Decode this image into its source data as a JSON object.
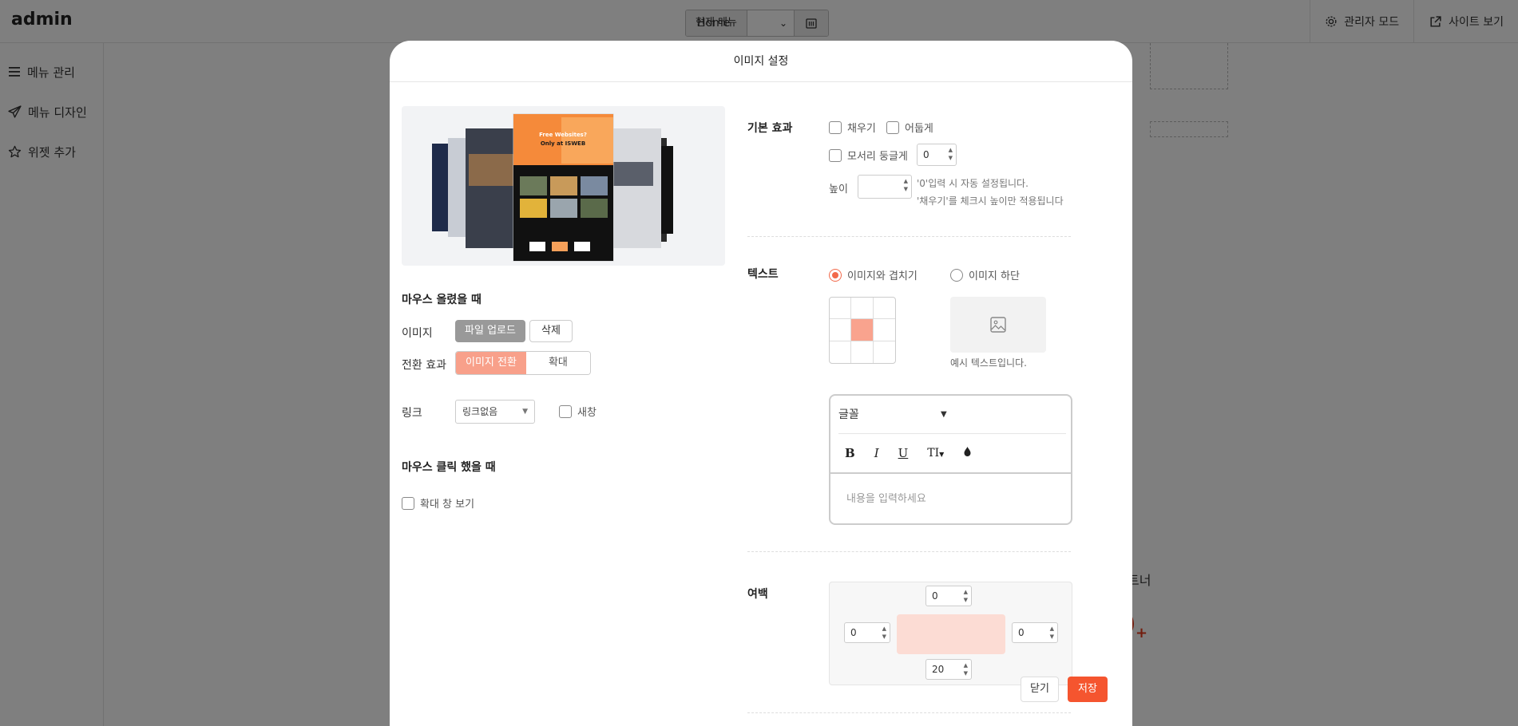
{
  "app": {
    "brand": "admin",
    "current_menu_label": "현재 메뉴",
    "current_menu_value": "Home",
    "admin_mode": "관리자 모드",
    "site_view": "사이트 보기"
  },
  "sidebar": {
    "items": [
      {
        "label": "메뉴 관리",
        "icon": "hamburger-icon"
      },
      {
        "label": "메뉴 디자인",
        "icon": "paper-plane-icon"
      },
      {
        "label": "위젯 추가",
        "icon": "star-icon"
      }
    ]
  },
  "background": {
    "partner_text": "트너"
  },
  "modal": {
    "title": "이미지 설정",
    "preview_headline": "Free Websites?",
    "preview_sub": "Only at ISWEB",
    "hover": {
      "title": "마우스 올렸을 때",
      "image_label": "이미지",
      "upload_button": "파일 업로드",
      "delete_button": "삭제",
      "transition_label": "전환 효과",
      "transition_options": [
        "이미지 전환",
        "확대"
      ],
      "link_label": "링크",
      "link_value": "링크없음",
      "new_window_label": "새창"
    },
    "click": {
      "title": "마우스 클릭 했을 때",
      "zoom_view_label": "확대 창 보기"
    },
    "basic_effect": {
      "title": "기본 효과",
      "fill_label": "채우기",
      "dark_label": "어둡게",
      "rounded_label": "모서리 둥글게",
      "rounded_value": "0",
      "height_label": "높이",
      "height_value": "",
      "hint_line1": "'0'입력 시 자동 설정됩니다.",
      "hint_line2": "'채우기'를 체크시 높이만 적용됩니다"
    },
    "text": {
      "title": "텍스트",
      "overlay_option": "이미지와 겹치기",
      "below_option": "이미지 하단",
      "sample_text": "예시 텍스트입니다.",
      "font_label": "글꼴",
      "tool_bold": "B",
      "tool_italic": "I",
      "tool_underline": "U",
      "tool_size": "TI",
      "placeholder": "내용을 입력하세요"
    },
    "margin": {
      "title": "여백",
      "top": "0",
      "left": "0",
      "right": "0",
      "bottom": "20"
    },
    "close_button": "닫기",
    "save_button": "저장"
  },
  "colors": {
    "accent": "#f5552f",
    "segment_active": "#f8a08a",
    "margin_inner": "#fcdcd4"
  }
}
